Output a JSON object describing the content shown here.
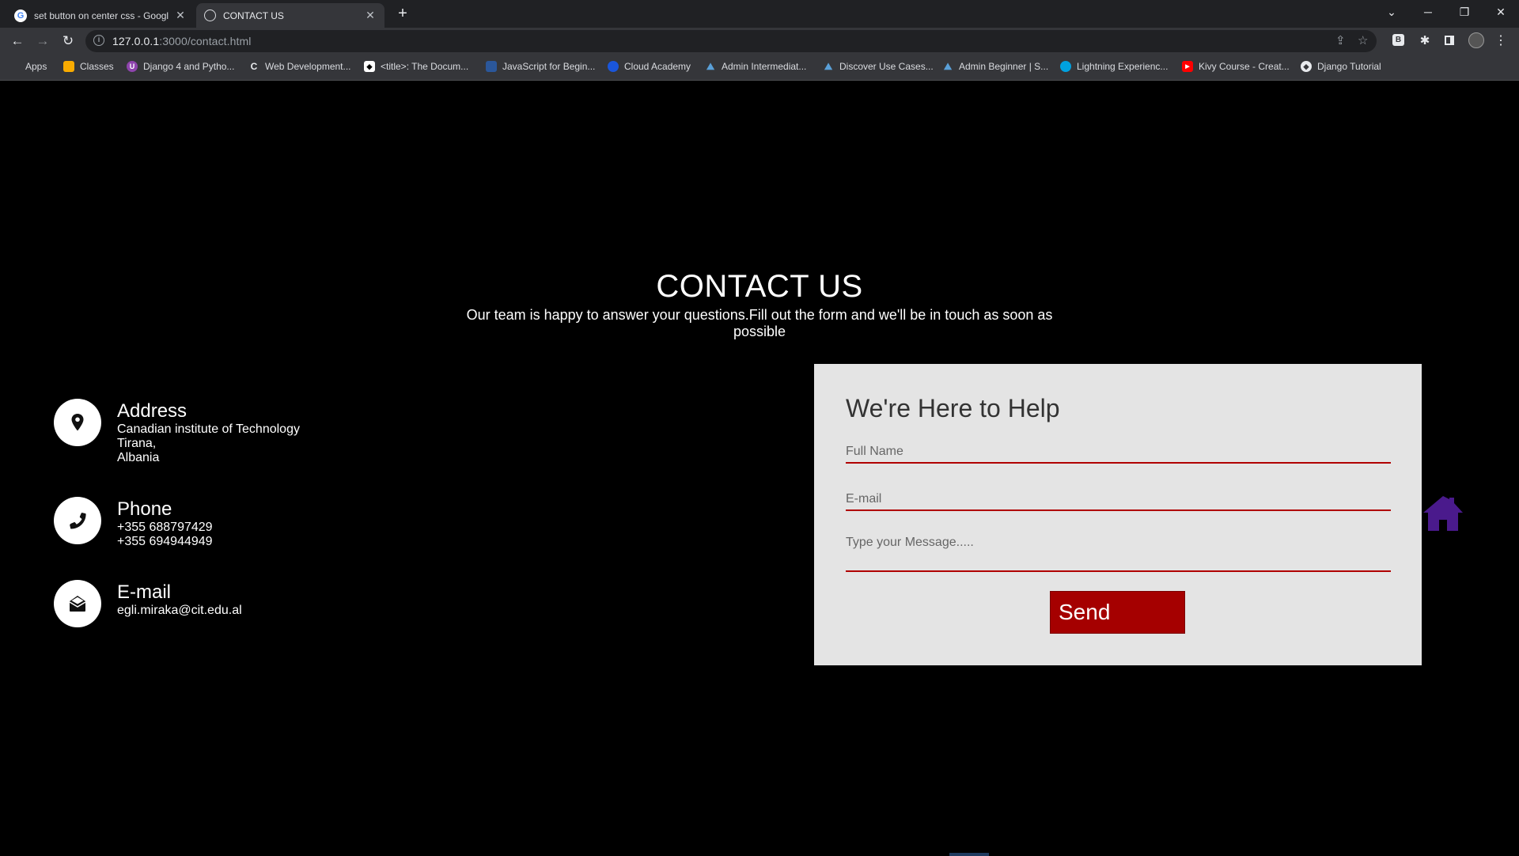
{
  "browser": {
    "tabs": [
      {
        "title": "set button on center css - Googl",
        "active": false
      },
      {
        "title": "CONTACT US",
        "active": true
      }
    ],
    "new_tab": "+",
    "url": {
      "host": "127.0.0.1",
      "path": ":3000/contact.html"
    },
    "bookmarks": [
      {
        "label": "Apps",
        "icon": "apps-grid-icon",
        "color": "#ea4335"
      },
      {
        "label": "Classes",
        "icon": "classroom-icon",
        "color": "#f9ab00"
      },
      {
        "label": "Django 4 and Pytho...",
        "icon": "udemy-icon",
        "color": "#8e44ad"
      },
      {
        "label": "Web Development...",
        "icon": "coursera-icon",
        "color": "#1a73e8"
      },
      {
        "label": "<title>: The Docum...",
        "icon": "mdn-icon",
        "color": "#000000"
      },
      {
        "label": "JavaScript for Begin...",
        "icon": "course-icon",
        "color": "#2b579a"
      },
      {
        "label": "Cloud Academy",
        "icon": "cloud-academy-icon",
        "color": "#1a56db"
      },
      {
        "label": "Admin Intermediat...",
        "icon": "trailhead-icon",
        "color": "#5aa0d8"
      },
      {
        "label": "Discover Use Cases...",
        "icon": "trailhead-icon",
        "color": "#5aa0d8"
      },
      {
        "label": "Admin Beginner | S...",
        "icon": "trailhead-icon",
        "color": "#5aa0d8"
      },
      {
        "label": "Lightning Experienc...",
        "icon": "salesforce-cloud-icon",
        "color": "#00a1e0"
      },
      {
        "label": "Kivy Course - Creat...",
        "icon": "youtube-icon",
        "color": "#ff0000"
      },
      {
        "label": "Django Tutorial",
        "icon": "django-icon",
        "color": "#e8eaed"
      }
    ]
  },
  "page": {
    "heading": "CONTACT US",
    "subtitle": "Our team is happy to answer your questions.Fill out the form and we'll be in touch as soon as possible",
    "contact_items": [
      {
        "icon": "map-pin-icon",
        "title": "Address",
        "lines": [
          "Canadian institute of Technology",
          "Tirana,",
          "Albania"
        ]
      },
      {
        "icon": "phone-icon",
        "title": "Phone",
        "lines": [
          "+355 688797429",
          "+355 694944949"
        ]
      },
      {
        "icon": "envelope-open-icon",
        "title": "E-mail",
        "lines": [
          "egli.miraka@cit.edu.al"
        ]
      }
    ],
    "form": {
      "title": "We're Here to Help",
      "full_name_placeholder": "Full Name",
      "email_placeholder": "E-mail",
      "message_placeholder": "Type your Message.....",
      "send_label": "Send"
    },
    "home_icon_color": "#4a1a8c",
    "accent_color": "#a50000"
  }
}
